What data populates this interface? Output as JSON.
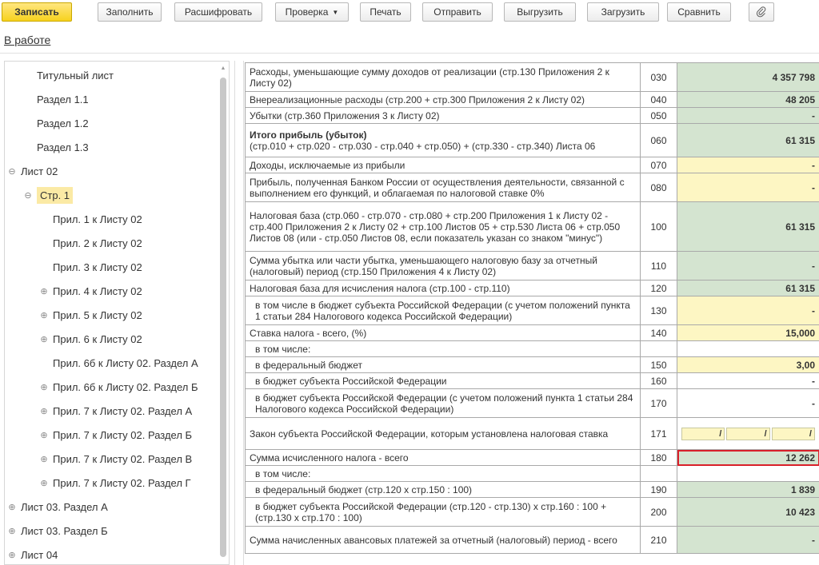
{
  "toolbar": {
    "save": "Записать",
    "fill": "Заполнить",
    "decode": "Расшифровать",
    "check": "Проверка",
    "print": "Печать",
    "send": "Отправить",
    "export": "Выгрузить",
    "import": "Загрузить",
    "compare": "Сравнить",
    "attach_icon": "paperclip-icon"
  },
  "status_link": "В работе",
  "tree": [
    {
      "label": "Титульный лист",
      "level": 1,
      "exp": ""
    },
    {
      "label": "Раздел 1.1",
      "level": 1,
      "exp": ""
    },
    {
      "label": "Раздел 1.2",
      "level": 1,
      "exp": ""
    },
    {
      "label": "Раздел 1.3",
      "level": 1,
      "exp": ""
    },
    {
      "label": "Лист 02",
      "level": 0,
      "exp": "⊖"
    },
    {
      "label": "Стр. 1",
      "level": 1,
      "exp": "⊖",
      "selected": true
    },
    {
      "label": "Прил. 1 к Листу 02",
      "level": 2,
      "exp": ""
    },
    {
      "label": "Прил. 2 к Листу 02",
      "level": 2,
      "exp": ""
    },
    {
      "label": "Прил. 3 к Листу 02",
      "level": 2,
      "exp": ""
    },
    {
      "label": "Прил. 4 к Листу 02",
      "level": 2,
      "exp": "⊕"
    },
    {
      "label": "Прил. 5 к Листу 02",
      "level": 2,
      "exp": "⊕"
    },
    {
      "label": "Прил. 6 к Листу 02",
      "level": 2,
      "exp": "⊕"
    },
    {
      "label": "Прил. 6б к Листу 02. Раздел А",
      "level": 2,
      "exp": ""
    },
    {
      "label": "Прил. 6б к Листу 02. Раздел Б",
      "level": 2,
      "exp": "⊕"
    },
    {
      "label": "Прил. 7 к Листу 02. Раздел А",
      "level": 2,
      "exp": "⊕"
    },
    {
      "label": "Прил. 7 к Листу 02. Раздел Б",
      "level": 2,
      "exp": "⊕"
    },
    {
      "label": "Прил. 7 к Листу 02. Раздел В",
      "level": 2,
      "exp": "⊕"
    },
    {
      "label": "Прил. 7 к Листу 02. Раздел Г",
      "level": 2,
      "exp": "⊕"
    },
    {
      "label": "Лист 03. Раздел А",
      "level": 0,
      "exp": "⊕"
    },
    {
      "label": "Лист 03. Раздел Б",
      "level": 0,
      "exp": "⊕"
    },
    {
      "label": "Лист 04",
      "level": 0,
      "exp": "⊕"
    }
  ],
  "rows": [
    {
      "desc": "Расходы, уменьшающие сумму доходов от реализации (стр.130 Приложения 2 к Листу 02)",
      "code": "030",
      "value": "4 357 798",
      "fill": "green"
    },
    {
      "desc": "Внереализационные расходы (стр.200 + стр.300 Приложения 2 к Листу 02)",
      "code": "040",
      "value": "48 205",
      "fill": "green"
    },
    {
      "desc": "Убытки (стр.360 Приложения 3 к Листу 02)",
      "code": "050",
      "value": "-",
      "fill": "green"
    },
    {
      "desc_bold": "Итого прибыль (убыток)",
      "desc": "(стр.010 + стр.020 - стр.030 - стр.040 + стр.050) + (стр.330 - стр.340) Листа 06",
      "code": "060",
      "value": "61 315",
      "fill": "green"
    },
    {
      "desc": "Доходы, исключаемые из прибыли",
      "code": "070",
      "value": "-",
      "fill": "yellow"
    },
    {
      "desc": "Прибыль, полученная Банком России от осуществления деятельности, связанной с выполнением его функций, и облагаемая по налоговой ставке 0%",
      "code": "080",
      "value": "-",
      "fill": "yellow"
    },
    {
      "desc": "Налоговая база (стр.060 - стр.070 - стр.080 + стр.200 Приложения 1 к Листу 02 - стр.400 Приложения 2 к Листу 02 + стр.100 Листов 05 + стр.530 Листа 06 + стр.050 Листов 08 (или - стр.050 Листов 08, если показатель указан со знаком \"минус\")",
      "code": "100",
      "value": "61 315",
      "fill": "green"
    },
    {
      "desc": "Сумма убытка или части убытка, уменьшающего налоговую базу за отчетный (налоговый) период (стр.150 Приложения 4 к Листу 02)",
      "code": "110",
      "value": "-",
      "fill": "green"
    },
    {
      "desc": "Налоговая база для исчисления налога (стр.100 - стр.110)",
      "code": "120",
      "value": "61 315",
      "fill": "green"
    },
    {
      "desc": "в том числе в бюджет субъекта Российской Федерации (с учетом положений пункта 1 статьи 284 Налогового кодекса Российской Федерации)",
      "code": "130",
      "value": "-",
      "fill": "yellow",
      "indent": true
    },
    {
      "desc": "Ставка налога - всего, (%)",
      "code": "140",
      "value": "15,000",
      "fill": "yellow"
    },
    {
      "desc": "в том числе:",
      "code": "",
      "value": "",
      "fill": "none",
      "indent": true
    },
    {
      "desc": "в федеральный бюджет",
      "code": "150",
      "value": "3,00",
      "fill": "yellow",
      "indent": true
    },
    {
      "desc": "в бюджет субъекта Российской Федерации",
      "code": "160",
      "value": "-",
      "fill": "white",
      "indent": true
    },
    {
      "desc": "в бюджет субъекта Российской Федерации (с учетом положений пункта 1 статьи 284 Налогового кодекса Российской Федерации)",
      "code": "170",
      "value": "-",
      "fill": "white",
      "indent": true
    },
    {
      "desc": "Закон субъекта Российской Федерации, которым установлена налоговая ставка",
      "code": "171",
      "value": "",
      "fill": "law",
      "law": [
        "/",
        "/",
        "/"
      ]
    },
    {
      "desc": "Сумма исчисленного налога - всего",
      "code": "180",
      "value": "12 262",
      "fill": "green",
      "highlight": true
    },
    {
      "desc": "в том числе:",
      "code": "",
      "value": "",
      "fill": "none",
      "indent": true
    },
    {
      "desc": "в федеральный бюджет (стр.120 х стр.150 : 100)",
      "code": "190",
      "value": "1 839",
      "fill": "green",
      "indent": true
    },
    {
      "desc": "в бюджет субъекта Российской Федерации (стр.120 - стр.130) х стр.160 : 100 + (стр.130 х стр.170 : 100)",
      "code": "200",
      "value": "10 423",
      "fill": "green",
      "indent": true
    },
    {
      "desc": "Сумма начисленных авансовых платежей за отчетный (налоговый) период - всего",
      "code": "210",
      "value": "-",
      "fill": "green"
    }
  ],
  "colors": {
    "green": "#d4e4d0",
    "yellow": "#fdf6c3",
    "highlight": "#d9202a",
    "primary": "#f7d21e"
  }
}
